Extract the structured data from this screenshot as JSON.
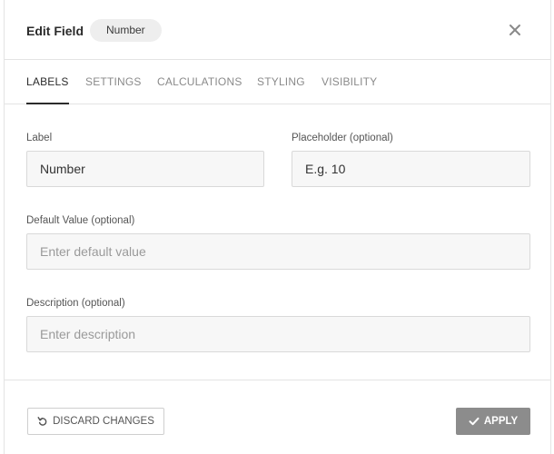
{
  "header": {
    "title": "Edit Field",
    "type_badge": "Number",
    "close_icon": "close-icon"
  },
  "tabs": [
    {
      "label": "LABELS",
      "active": true
    },
    {
      "label": "SETTINGS",
      "active": false
    },
    {
      "label": "CALCULATIONS",
      "active": false
    },
    {
      "label": "STYLING",
      "active": false
    },
    {
      "label": "VISIBILITY",
      "active": false
    }
  ],
  "form": {
    "label": {
      "label": "Label",
      "value": "Number"
    },
    "placeholder": {
      "label": "Placeholder (optional)",
      "value": "E.g. 10"
    },
    "default_value": {
      "label": "Default Value (optional)",
      "value": "",
      "placeholder": "Enter default value"
    },
    "description": {
      "label": "Description (optional)",
      "value": "",
      "placeholder": "Enter description"
    }
  },
  "footer": {
    "discard_label": "DISCARD CHANGES",
    "discard_icon": "undo-icon",
    "apply_label": "APPLY",
    "apply_icon": "check-icon"
  },
  "colors": {
    "active_tab": "#2b2b2b",
    "inactive_tab": "#8a8a8a",
    "apply_button_bg": "#8c8c8c"
  }
}
